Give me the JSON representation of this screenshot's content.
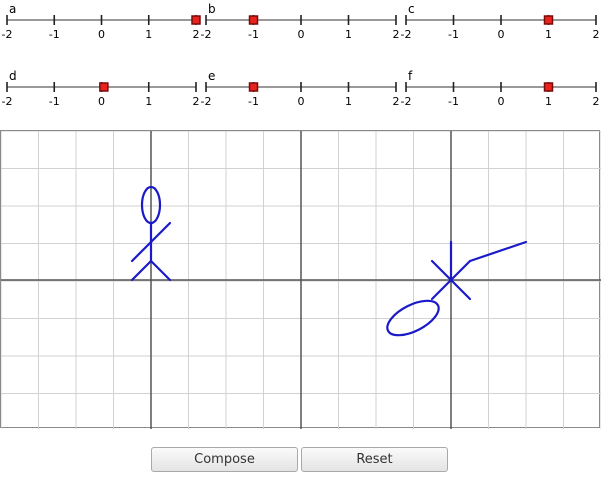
{
  "sliders": [
    {
      "label": "a",
      "value": 2,
      "ticks": [
        "-2",
        "-1",
        "0",
        "1",
        "2"
      ]
    },
    {
      "label": "b",
      "value": -1,
      "ticks": [
        "-2",
        "-1",
        "0",
        "1",
        "2"
      ]
    },
    {
      "label": "c",
      "value": 1,
      "ticks": [
        "-2",
        "-1",
        "0",
        "1",
        "2"
      ]
    },
    {
      "label": "d",
      "value": 0.05,
      "ticks": [
        "-2",
        "-1",
        "0",
        "1",
        "2"
      ]
    },
    {
      "label": "e",
      "value": -1,
      "ticks": [
        "-2",
        "-1",
        "0",
        "1",
        "2"
      ]
    },
    {
      "label": "f",
      "value": 1,
      "ticks": [
        "-2",
        "-1",
        "0",
        "1",
        "2"
      ]
    }
  ],
  "buttons": {
    "compose_label": "Compose",
    "reset_label": "Reset"
  },
  "colors": {
    "figure": "#1a1ac8",
    "handle": "#e8231d",
    "grid": "#d2d2d2",
    "axis": "#555555"
  }
}
